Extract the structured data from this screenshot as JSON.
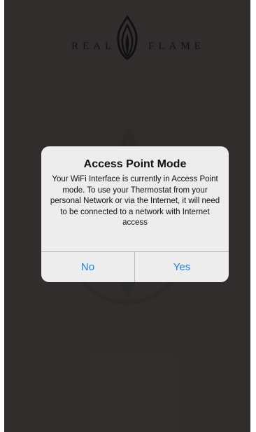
{
  "brand": {
    "left_word": "REAL",
    "right_word": "FLAME"
  },
  "alert": {
    "title": "Access Point Mode",
    "message": "Your WiFi Interface is currently in Access Point mode. To use your Thermostat from your personal Network or via the Internet, it will need to be connected to a network with Internet access",
    "no_label": "No",
    "yes_label": "Yes"
  },
  "colors": {
    "background": "#3c3838",
    "dialog": "#ededed",
    "button_text": "#1a7cf5"
  }
}
